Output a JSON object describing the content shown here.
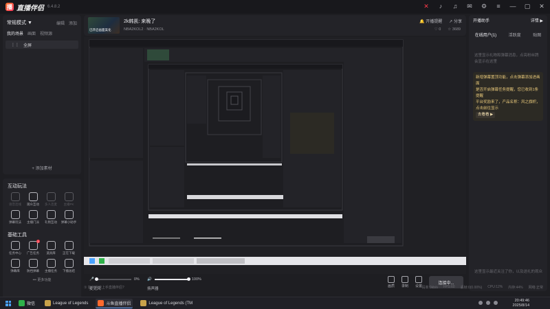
{
  "app": {
    "title": "直播伴侣",
    "version": "6.4.8.2",
    "titlebar_icons": [
      "x-brand-icon",
      "notification-icon",
      "headset-icon",
      "mail-icon",
      "settings-icon",
      "menu-icon",
      "minimize-icon",
      "maximize-icon",
      "close-icon"
    ]
  },
  "scene": {
    "mode": "常规模式 ▼",
    "actions": [
      "编辑",
      "添加"
    ],
    "tabs": [
      "我的场景",
      "画面",
      "视频源"
    ],
    "items": [
      {
        "label": "全屏"
      }
    ],
    "add_source": "+ 添加素材"
  },
  "interactive": {
    "title": "互动玩法",
    "tools": [
      {
        "label": "语音连线",
        "icon": "mic-icon",
        "enabled": false
      },
      {
        "label": "观众互动",
        "icon": "shield-icon",
        "enabled": true
      },
      {
        "label": "多人连麦",
        "icon": "people-icon",
        "enabled": false
      },
      {
        "label": "主播PK",
        "icon": "pk-icon",
        "enabled": false
      },
      {
        "label": "弹幕玩法",
        "icon": "danmaku-icon",
        "enabled": true
      },
      {
        "label": "主播门派",
        "icon": "clan-icon",
        "enabled": true
      },
      {
        "label": "礼物互动",
        "icon": "gift-icon",
        "enabled": true
      },
      {
        "label": "弹幕小助手",
        "icon": "assistant-icon",
        "enabled": true
      }
    ]
  },
  "basic": {
    "title": "基础工具",
    "tools": [
      {
        "label": "任务中心",
        "icon": "task-icon",
        "badge": ""
      },
      {
        "label": "广告任务",
        "icon": "ad-icon",
        "badge": "1"
      },
      {
        "label": "道具库",
        "icon": "prop-icon",
        "badge": ""
      },
      {
        "label": "正在下载",
        "icon": "download-icon",
        "badge": ""
      },
      {
        "label": "弹幕库",
        "icon": "library-icon",
        "badge": ""
      },
      {
        "label": "防挡弹幕",
        "icon": "shield-danmaku-icon",
        "badge": ""
      },
      {
        "label": "主播任务",
        "icon": "anchor-task-icon",
        "badge": ""
      },
      {
        "label": "下播总结",
        "icon": "summary-icon",
        "badge": ""
      }
    ],
    "more": "••• 更多功能"
  },
  "room": {
    "thumb_text": "已开启画面美化",
    "title": "2k韩凯: 来晚了",
    "category": "NBA2KOL2 · NBA2KOL",
    "actions": [
      "开播提醒",
      "分享"
    ],
    "stats": [
      "0",
      "3689"
    ]
  },
  "preview": {
    "taskbar_apps": [
      "微信",
      "League of Legends",
      "斗鱼直播伴侣",
      "League of Legends (TM"
    ]
  },
  "audio": {
    "mic_label": "麦克风",
    "mic_value": "0%",
    "mic_level": 0,
    "speaker_label": "扬声器",
    "speaker_value": "100%",
    "speaker_level": 1
  },
  "controls": {
    "buttons": [
      "画质",
      "录制",
      "设置"
    ],
    "live_button": "连接中..."
  },
  "danmaku": {
    "header_title": "开播助手",
    "header_right": "详情 ▶",
    "tabs": [
      "在线用户(1)",
      "活跃度",
      "贴图"
    ],
    "empty_text": "这里显示礼物和弹幕消息，点亮粉丝牌会显示在这里",
    "tip_lines": [
      "新增弹幕置顶功能，点击弹幕添加进画面",
      "是否开启弹幕任务提醒，您已收到1条提醒",
      "平台奖励来了，产品名称：风之旗帜，点击前往显示"
    ],
    "tip_button": "去看看 ▶",
    "footer_text": "这里显示最近关注了你，以及送礼的观众"
  },
  "statusbar": {
    "hint": "① 如何快速上手直播伴侣?",
    "stats": [
      "码率:0kb/s",
      "FPS:60",
      "丢帧:0(0.00%)",
      "CPU:12%",
      "内存:44%",
      "网络:正常"
    ]
  },
  "taskbar": {
    "apps": [
      {
        "label": "微信",
        "color": "#2fb24a",
        "active": false
      },
      {
        "label": "League of Legends",
        "color": "#c8a24a",
        "active": false
      },
      {
        "label": "斗鱼直播伴侣",
        "color": "#ff6a2e",
        "active": true
      },
      {
        "label": "League of Legends (TM",
        "color": "#c8a24a",
        "active": false
      }
    ],
    "time": "20:49:46",
    "date": "2025/8/14"
  }
}
